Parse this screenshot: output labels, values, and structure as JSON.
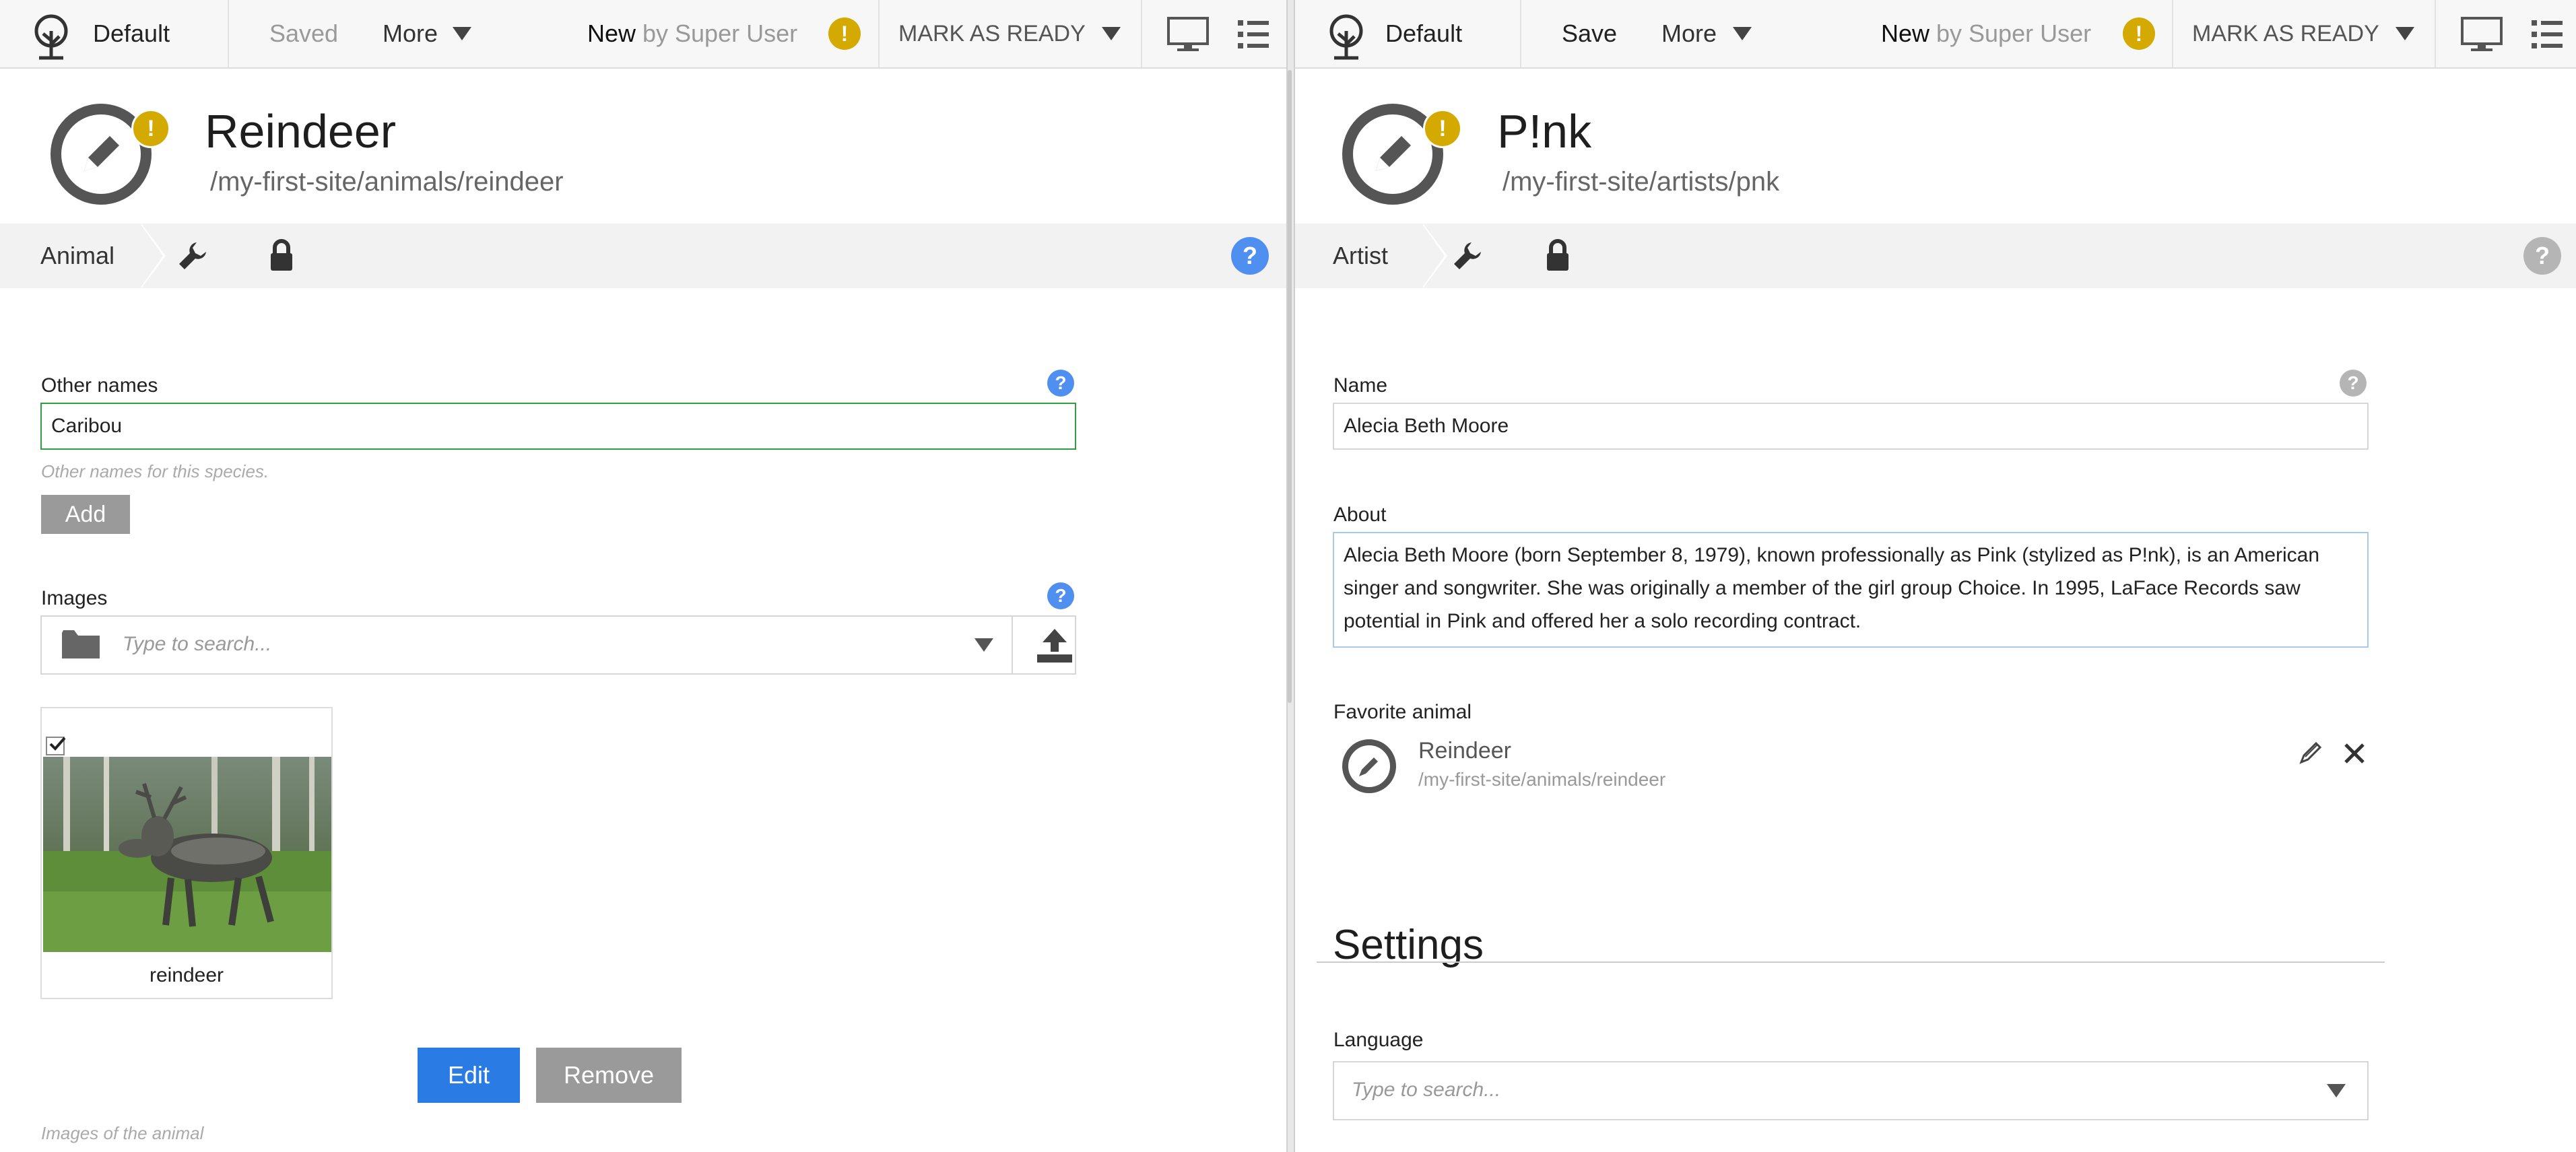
{
  "left": {
    "toolbar": {
      "project": "Default",
      "save_label": "Saved",
      "more_label": "More",
      "status": "New",
      "by": "by Super User",
      "workflow_label": "MARK AS READY"
    },
    "header": {
      "title": "Reindeer",
      "path": "/my-first-site/animals/reindeer"
    },
    "tabs": {
      "active": "Animal"
    },
    "form": {
      "other_names": {
        "label": "Other names",
        "value": "Caribou",
        "hint": "Other names for this species.",
        "add_label": "Add"
      },
      "images": {
        "label": "Images",
        "placeholder": "Type to search...",
        "item_caption": "reindeer",
        "edit_label": "Edit",
        "remove_label": "Remove",
        "hint": "Images of the animal"
      }
    }
  },
  "right": {
    "toolbar": {
      "project": "Default",
      "save_label": "Save",
      "more_label": "More",
      "status": "New",
      "by": "by Super User",
      "workflow_label": "MARK AS READY"
    },
    "header": {
      "title": "P!nk",
      "path": "/my-first-site/artists/pnk"
    },
    "tabs": {
      "active": "Artist"
    },
    "form": {
      "name": {
        "label": "Name",
        "value": "Alecia Beth Moore"
      },
      "about": {
        "label": "About",
        "value": "Alecia Beth Moore (born September 8, 1979), known professionally as Pink (stylized as P!nk), is an American singer and songwriter. She was originally a member of the girl group Choice. In 1995, LaFace Records saw potential in Pink and offered her a solo recording contract."
      },
      "favorite_animal": {
        "label": "Favorite animal",
        "title": "Reindeer",
        "path": "/my-first-site/animals/reindeer"
      },
      "settings": {
        "title": "Settings",
        "language_label": "Language",
        "language_placeholder": "Type to search..."
      }
    }
  },
  "colors": {
    "accent_blue": "#2a7be4",
    "warning_yellow": "#d4a900",
    "help_blue": "#4f8ff0",
    "valid_green": "#2f9e3f"
  }
}
